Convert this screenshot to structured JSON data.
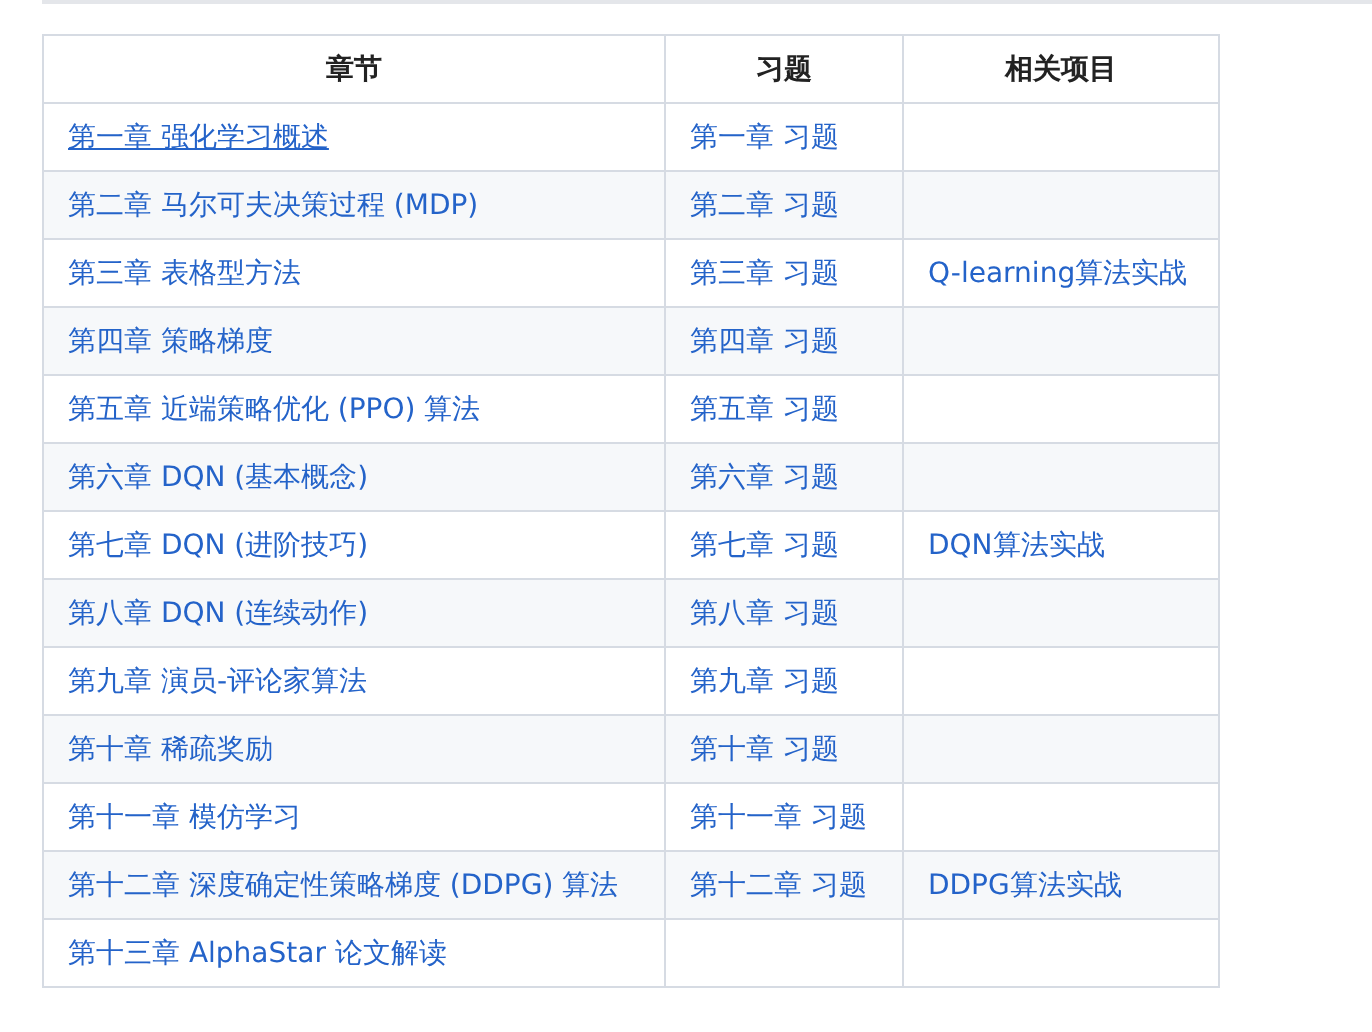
{
  "table": {
    "columns": [
      "章节",
      "习题",
      "相关项目"
    ],
    "rows": [
      {
        "chapter": "第一章 强化学习概述",
        "underlined": true,
        "exercise": "第一章 习题"
      },
      {
        "chapter": "第二章 马尔可夫决策过程 (MDP)",
        "underlined": false,
        "exercise": "第二章 习题"
      },
      {
        "chapter": "第三章 表格型方法",
        "underlined": false,
        "exercise": "第三章 习题",
        "project": "Q-learning算法实战"
      },
      {
        "chapter": "第四章 策略梯度",
        "underlined": false,
        "exercise": "第四章 习题"
      },
      {
        "chapter": "第五章 近端策略优化 (PPO) 算法",
        "underlined": false,
        "exercise": "第五章 习题"
      },
      {
        "chapter": "第六章 DQN (基本概念)",
        "underlined": false,
        "exercise": "第六章 习题"
      },
      {
        "chapter": "第七章 DQN (进阶技巧)",
        "underlined": false,
        "exercise": "第七章 习题",
        "project": "DQN算法实战"
      },
      {
        "chapter": "第八章 DQN (连续动作)",
        "underlined": false,
        "exercise": "第八章 习题"
      },
      {
        "chapter": "第九章 演员-评论家算法",
        "underlined": false,
        "exercise": "第九章 习题"
      },
      {
        "chapter": "第十章 稀疏奖励",
        "underlined": false,
        "exercise": "第十章 习题"
      },
      {
        "chapter": "第十一章 模仿学习",
        "underlined": false,
        "exercise": "第十一章 习题"
      },
      {
        "chapter": "第十二章 深度确定性策略梯度 (DDPG) 算法",
        "underlined": false,
        "exercise": "第十二章 习题",
        "project": "DDPG算法实战"
      },
      {
        "chapter": "第十三章 AlphaStar 论文解读",
        "underlined": false
      }
    ]
  }
}
